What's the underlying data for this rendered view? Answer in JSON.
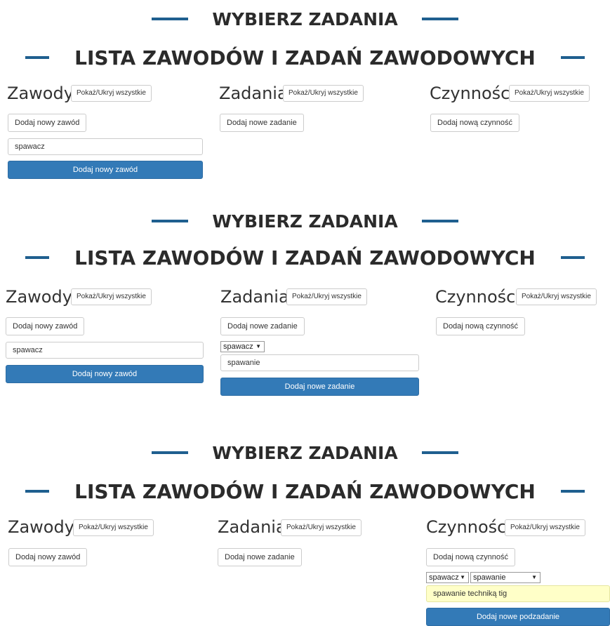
{
  "headers": {
    "choose": "WYBIERZ ZADANIA",
    "list": "LISTA ZAWODÓW I ZADAŃ ZAWODOWYCH"
  },
  "columns": {
    "professions": "Zawody",
    "tasks": "Zadania",
    "activities": "Czynności"
  },
  "toggle_all": "Pokaż/Ukryj wszystkie",
  "buttons": {
    "add_profession": "Dodaj nowy zawód",
    "add_task": "Dodaj nowe zadanie",
    "add_activity": "Dodaj nową czynność",
    "add_subtask": "Dodaj nowe podzadanie"
  },
  "values": {
    "profession": "spawacz",
    "task": "spawanie",
    "activity": "spawanie techniką tig"
  },
  "colors": {
    "accent_line": "#1f5f8f",
    "primary": "#337ab7",
    "highlight_input": "#ffffc8"
  }
}
